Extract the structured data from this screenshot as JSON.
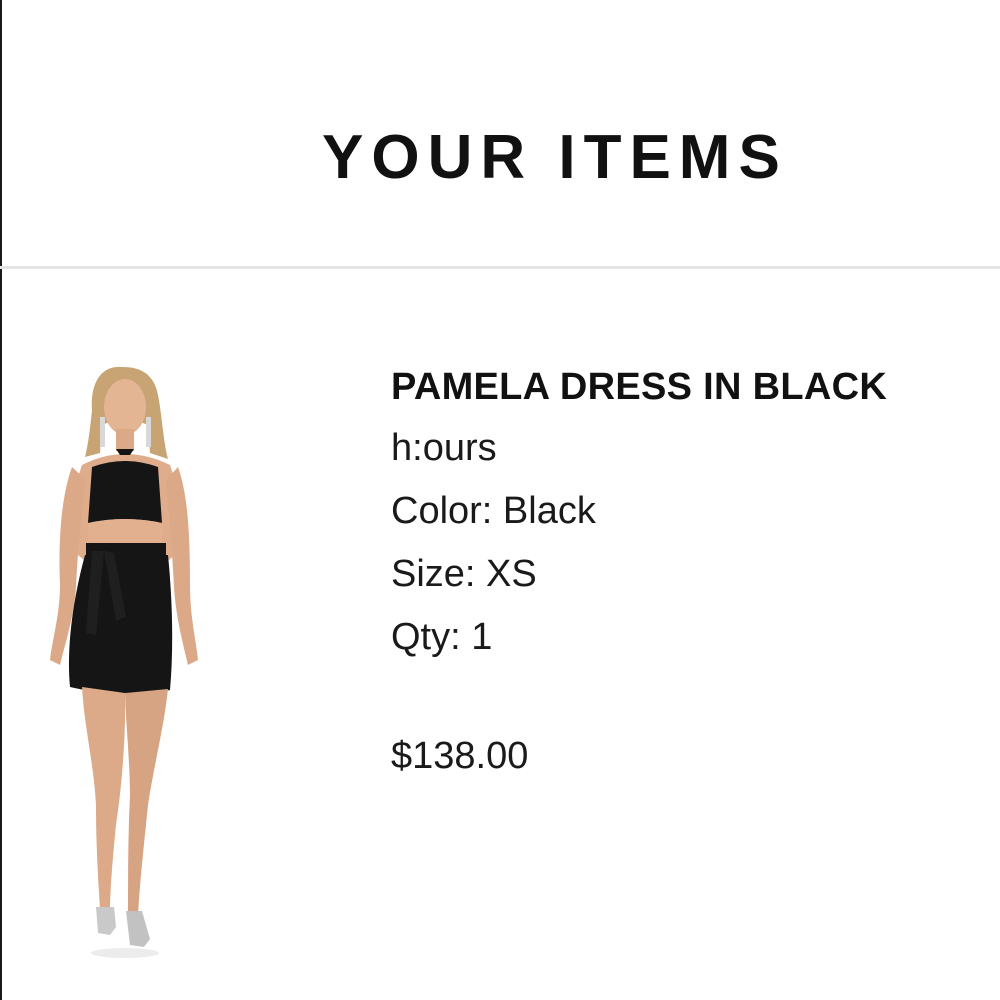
{
  "header": {
    "title": "YOUR ITEMS"
  },
  "item": {
    "image_icon": "dress-photo",
    "name": "PAMELA DRESS IN BLACK",
    "brand": "h:ours",
    "color": "Color: Black",
    "size": "Size: XS",
    "qty": "Qty: 1",
    "price": "$138.00"
  },
  "colors": {
    "text": "#111111",
    "divider": "#e4e4e4",
    "background": "#ffffff",
    "dress": "#151515"
  }
}
